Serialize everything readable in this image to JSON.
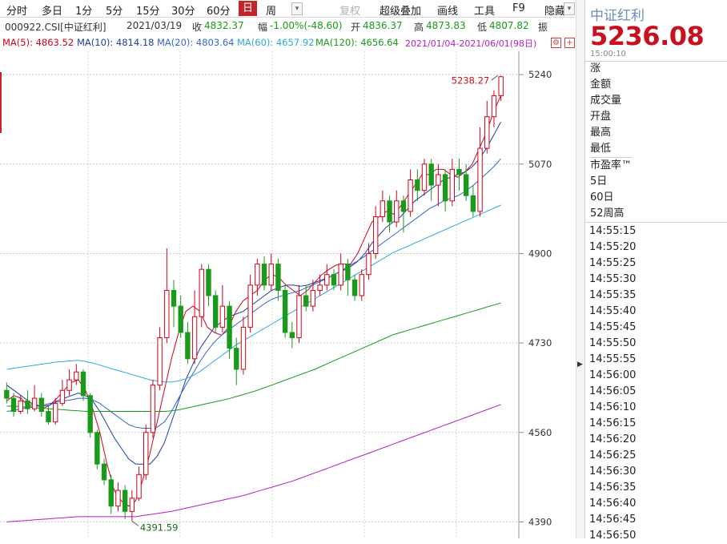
{
  "toolbar": {
    "periods": [
      "分时",
      "多日",
      "1分",
      "5分",
      "15分",
      "30分",
      "60分",
      "日",
      "周"
    ],
    "active": "日",
    "fuquan": "复权",
    "overlay": "超级叠加",
    "draw": "画线",
    "tools": "工具",
    "f9": "F9",
    "hide": "隐藏"
  },
  "info": {
    "code": "000922.CSI[中证红利]",
    "date": "2021/03/19",
    "close_label": "收",
    "close": "4832.37",
    "change_label": "幅",
    "change": "-1.00%(-48.60)",
    "open_label": "开",
    "open": "4836.37",
    "high_label": "高",
    "high": "4873.83",
    "low_label": "低",
    "low": "4807.82",
    "amp_label": "振"
  },
  "ma": {
    "ma5": "MA(5): 4863.52",
    "ma10": "MA(10): 4814.18",
    "ma20": "MA(20): 4803.64",
    "ma60": "MA(60): 4657.92",
    "ma120": "MA(120): 4656.64",
    "range": "2021/01/04-2021/06/01(98日)",
    "colors": {
      "ma5": "#d0021b",
      "ma10": "#1a3f9c",
      "ma20": "#3366cc",
      "ma60": "#2fa8d8",
      "ma120": "#1a9a1a",
      "ma250": "#b020c0"
    }
  },
  "chart_data": {
    "type": "candlestick",
    "y_ticks": [
      "5240",
      "5070",
      "4900",
      "4730",
      "4560",
      "4390"
    ],
    "ylim": [
      4380,
      5260
    ],
    "max_label": "5238.27",
    "min_label": "4391.59",
    "colors": {
      "up": "#d0021b",
      "down": "#1a9a1a"
    },
    "series": [
      {
        "name": "MA(5)",
        "values": [
          4620,
          4630,
          4625,
          4610,
          4615,
          4605,
          4612,
          4625,
          4640,
          4655,
          4660,
          4640,
          4605,
          4560,
          4500,
          4450,
          4430,
          4420,
          4430,
          4470,
          4520,
          4580,
          4640,
          4700,
          4750,
          4790,
          4800,
          4790,
          4760,
          4750,
          4745,
          4760,
          4790,
          4810,
          4820,
          4830,
          4850,
          4860,
          4855,
          4840,
          4830,
          4820,
          4830,
          4845,
          4860,
          4870,
          4878,
          4880,
          4880,
          4900,
          4930,
          4960,
          4970,
          4980,
          4975,
          4990,
          5010,
          5030,
          5050,
          5050,
          5060,
          5060,
          5050,
          5045,
          5055,
          5070,
          5100,
          5130,
          5170,
          5200
        ]
      },
      {
        "name": "MA(10)",
        "values": [
          4650,
          4640,
          4630,
          4620,
          4610,
          4610,
          4612,
          4620,
          4625,
          4630,
          4635,
          4630,
          4620,
          4600,
          4575,
          4550,
          4530,
          4510,
          4500,
          4500,
          4500,
          4515,
          4540,
          4580,
          4620,
          4660,
          4690,
          4720,
          4740,
          4760,
          4770,
          4780,
          4785,
          4790,
          4800,
          4810,
          4820,
          4830,
          4835,
          4840,
          4840,
          4838,
          4840,
          4845,
          4850,
          4855,
          4862,
          4868,
          4875,
          4885,
          4900,
          4920,
          4935,
          4950,
          4960,
          4970,
          4985,
          5000,
          5010,
          5020,
          5030,
          5040,
          5045,
          5050,
          5055,
          5065,
          5080,
          5100,
          5125,
          5150
        ]
      },
      {
        "name": "MA(20)",
        "values": [
          4600,
          4602,
          4605,
          4608,
          4610,
          4612,
          4615,
          4618,
          4620,
          4622,
          4625,
          4625,
          4622,
          4615,
          4605,
          4595,
          4585,
          4575,
          4570,
          4568,
          4568,
          4570,
          4580,
          4600,
          4625,
          4650,
          4672,
          4695,
          4715,
          4732,
          4745,
          4755,
          4765,
          4775,
          4785,
          4795,
          4805,
          4813,
          4818,
          4822,
          4826,
          4830,
          4836,
          4842,
          4848,
          4855,
          4862,
          4870,
          4878,
          4886,
          4895,
          4905,
          4915,
          4925,
          4935,
          4945,
          4955,
          4965,
          4975,
          4985,
          4992,
          5000,
          5005,
          5010,
          5018,
          5028,
          5040,
          5052,
          5065,
          5080
        ]
      },
      {
        "name": "MA(60)",
        "values": [
          4680,
          4682,
          4684,
          4686,
          4688,
          4690,
          4692,
          4694,
          4695,
          4696,
          4697,
          4695,
          4692,
          4688,
          4684,
          4680,
          4676,
          4672,
          4668,
          4664,
          4660,
          4658,
          4656,
          4656,
          4658,
          4662,
          4668,
          4676,
          4686,
          4696,
          4706,
          4716,
          4726,
          4734,
          4742,
          4750,
          4758,
          4766,
          4774,
          4782,
          4790,
          4798,
          4806,
          4814,
          4822,
          4830,
          4838,
          4846,
          4854,
          4862,
          4870,
          4878,
          4886,
          4894,
          4902,
          4908,
          4914,
          4920,
          4926,
          4932,
          4938,
          4944,
          4950,
          4956,
          4962,
          4968,
          4974,
          4980,
          4986,
          4992
        ]
      },
      {
        "name": "MA(120)",
        "values": [
          4610,
          4610,
          4609,
          4608,
          4607,
          4606,
          4605,
          4604,
          4603,
          4602,
          4601,
          4600,
          4600,
          4600,
          4600,
          4600,
          4600,
          4600,
          4600,
          4600,
          4600,
          4600,
          4600,
          4601,
          4603,
          4606,
          4609,
          4612,
          4615,
          4618,
          4621,
          4624,
          4628,
          4632,
          4636,
          4640,
          4645,
          4650,
          4655,
          4660,
          4665,
          4670,
          4675,
          4680,
          4686,
          4692,
          4698,
          4704,
          4710,
          4716,
          4722,
          4728,
          4734,
          4740,
          4746,
          4750,
          4754,
          4758,
          4762,
          4766,
          4770,
          4774,
          4778,
          4782,
          4786,
          4790,
          4794,
          4798,
          4802,
          4806
        ]
      },
      {
        "name": "MA(250)",
        "values": [
          4390,
          4391,
          4392,
          4393,
          4394,
          4395,
          4396,
          4397,
          4398,
          4399,
          4400,
          4400,
          4400,
          4400,
          4400,
          4400,
          4400,
          4400,
          4400,
          4402,
          4404,
          4406,
          4408,
          4410,
          4413,
          4416,
          4419,
          4422,
          4425,
          4428,
          4431,
          4434,
          4437,
          4440,
          4444,
          4448,
          4452,
          4456,
          4460,
          4464,
          4468,
          4473,
          4478,
          4483,
          4488,
          4493,
          4498,
          4503,
          4508,
          4513,
          4518,
          4523,
          4528,
          4533,
          4538,
          4543,
          4548,
          4553,
          4558,
          4563,
          4568,
          4573,
          4578,
          4583,
          4588,
          4593,
          4598,
          4603,
          4608,
          4613
        ]
      }
    ],
    "candles": [
      [
        4640,
        4625,
        4655,
        4615
      ],
      [
        4625,
        4600,
        4635,
        4590
      ],
      [
        4600,
        4620,
        4630,
        4595
      ],
      [
        4620,
        4605,
        4640,
        4595
      ],
      [
        4605,
        4625,
        4650,
        4600
      ],
      [
        4625,
        4600,
        4635,
        4590
      ],
      [
        4600,
        4580,
        4610,
        4575
      ],
      [
        4580,
        4615,
        4625,
        4575
      ],
      [
        4615,
        4640,
        4660,
        4610
      ],
      [
        4640,
        4660,
        4680,
        4630
      ],
      [
        4660,
        4675,
        4690,
        4650
      ],
      [
        4675,
        4630,
        4680,
        4620
      ],
      [
        4630,
        4560,
        4635,
        4550
      ],
      [
        4560,
        4500,
        4565,
        4490
      ],
      [
        4500,
        4470,
        4510,
        4460
      ],
      [
        4470,
        4420,
        4480,
        4405
      ],
      [
        4420,
        4450,
        4465,
        4410
      ],
      [
        4450,
        4410,
        4460,
        4395
      ],
      [
        4410,
        4435,
        4450,
        4392
      ],
      [
        4435,
        4480,
        4495,
        4430
      ],
      [
        4480,
        4560,
        4575,
        4470
      ],
      [
        4560,
        4650,
        4660,
        4550
      ],
      [
        4650,
        4740,
        4760,
        4640
      ],
      [
        4740,
        4830,
        4910,
        4730
      ],
      [
        4830,
        4800,
        4850,
        4760
      ],
      [
        4800,
        4750,
        4820,
        4740
      ],
      [
        4750,
        4700,
        4770,
        4690
      ],
      [
        4700,
        4780,
        4830,
        4690
      ],
      [
        4780,
        4870,
        4880,
        4760
      ],
      [
        4870,
        4820,
        4880,
        4800
      ],
      [
        4820,
        4760,
        4830,
        4750
      ],
      [
        4760,
        4800,
        4840,
        4750
      ],
      [
        4800,
        4720,
        4810,
        4700
      ],
      [
        4720,
        4680,
        4740,
        4650
      ],
      [
        4680,
        4760,
        4780,
        4670
      ],
      [
        4760,
        4840,
        4860,
        4750
      ],
      [
        4840,
        4880,
        4890,
        4820
      ],
      [
        4880,
        4840,
        4895,
        4830
      ],
      [
        4840,
        4880,
        4900,
        4830
      ],
      [
        4880,
        4830,
        4890,
        4810
      ],
      [
        4830,
        4750,
        4840,
        4740
      ],
      [
        4750,
        4740,
        4770,
        4720
      ],
      [
        4740,
        4820,
        4840,
        4730
      ],
      [
        4820,
        4800,
        4840,
        4790
      ],
      [
        4800,
        4830,
        4850,
        4790
      ],
      [
        4830,
        4840,
        4860,
        4820
      ],
      [
        4840,
        4860,
        4880,
        4830
      ],
      [
        4860,
        4840,
        4870,
        4830
      ],
      [
        4840,
        4880,
        4900,
        4830
      ],
      [
        4880,
        4850,
        4890,
        4820
      ],
      [
        4850,
        4820,
        4860,
        4810
      ],
      [
        4820,
        4860,
        4870,
        4810
      ],
      [
        4860,
        4900,
        4920,
        4850
      ],
      [
        4900,
        4970,
        4990,
        4890
      ],
      [
        4970,
        5000,
        5020,
        4960
      ],
      [
        5000,
        4960,
        5010,
        4940
      ],
      [
        4960,
        5000,
        5020,
        4950
      ],
      [
        5000,
        4980,
        5010,
        4940
      ],
      [
        4980,
        5040,
        5060,
        4970
      ],
      [
        5040,
        5020,
        5060,
        5000
      ],
      [
        5020,
        5070,
        5080,
        5010
      ],
      [
        5070,
        5030,
        5080,
        5000
      ],
      [
        5030,
        5050,
        5070,
        4990
      ],
      [
        5050,
        5000,
        5060,
        4980
      ],
      [
        5000,
        5060,
        5080,
        4990
      ],
      [
        5060,
        5050,
        5080,
        5020
      ],
      [
        5050,
        5010,
        5070,
        5000
      ],
      [
        5010,
        4980,
        5030,
        4970
      ],
      [
        4980,
        5100,
        5140,
        4970
      ],
      [
        5100,
        5160,
        5190,
        5090
      ],
      [
        5160,
        5200,
        5210,
        5140
      ],
      [
        5200,
        5236,
        5238,
        5190
      ]
    ]
  },
  "right": {
    "name": "中证红利",
    "price": "5236.08",
    "time": "15:00:10",
    "labels": [
      "涨",
      "金额",
      "成交量",
      "开盘",
      "最高",
      "最低",
      "市盈率™",
      "5日",
      "60日",
      "52周高"
    ],
    "ticks": [
      "14:55:15",
      "14:55:20",
      "14:55:25",
      "14:55:30",
      "14:55:35",
      "14:55:40",
      "14:55:45",
      "14:55:50",
      "14:55:55",
      "14:56:00",
      "14:56:05",
      "14:56:10",
      "14:56:15",
      "14:56:20",
      "14:56:25",
      "14:56:30",
      "14:56:35",
      "14:56:40",
      "14:56:45",
      "14:56:50"
    ]
  },
  "divider": {
    "arrow": "▶"
  }
}
